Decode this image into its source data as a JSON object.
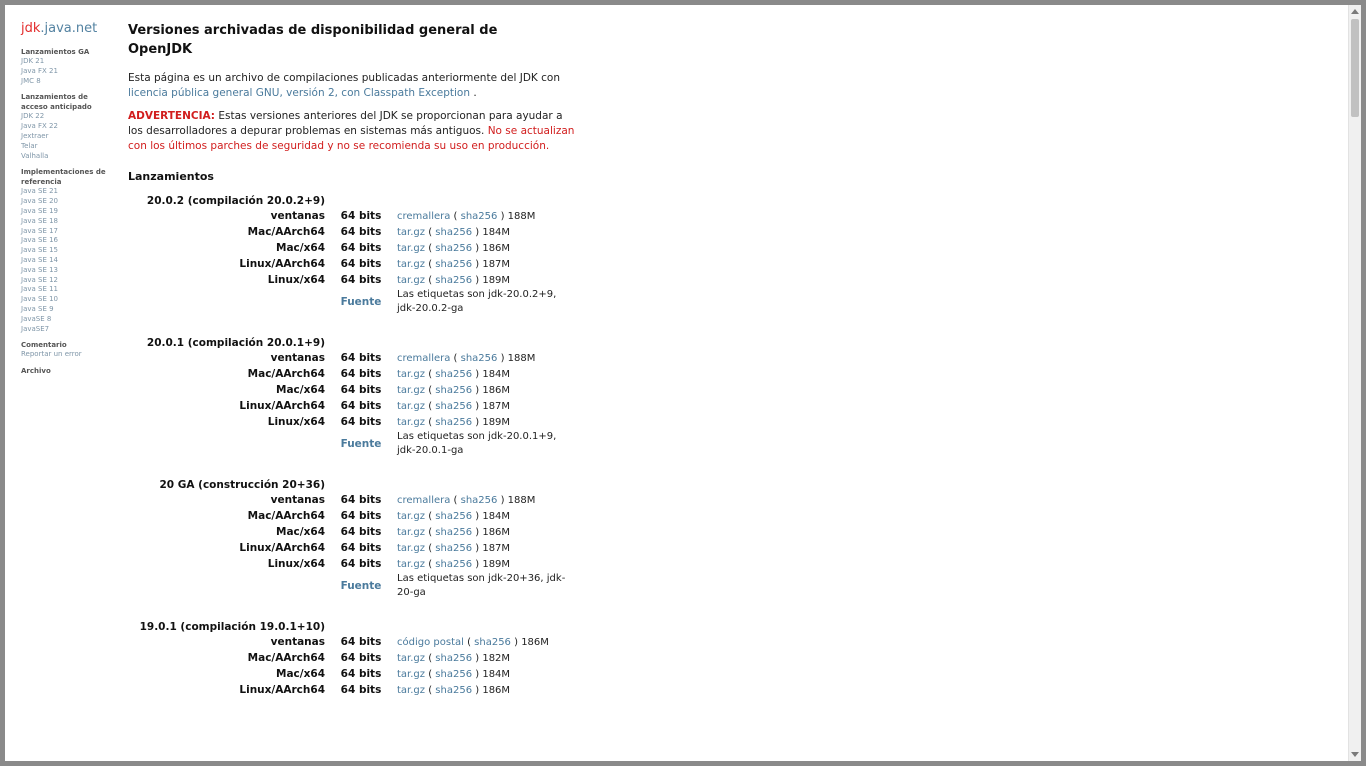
{
  "sidebar": {
    "logo_jdk": "jdk",
    "logo_rest": ".java.net",
    "groups": [
      {
        "head": "Lanzamientos GA",
        "links": [
          "JDK 21",
          "Java FX 21",
          "JMC 8"
        ]
      },
      {
        "head": "Lanzamientos de acceso anticipado",
        "links": [
          "JDK 22",
          "Java FX 22",
          "Jextraer",
          "Telar",
          "Valhalla"
        ]
      },
      {
        "head": "Implementaciones de referencia",
        "links": [
          "Java SE 21",
          "Java SE 20",
          "Java SE 19",
          "Java SE 18",
          "Java SE 17",
          "Java SE 16",
          "Java SE 15",
          "Java SE 14",
          "Java SE 13",
          "Java SE 12",
          "Java SE 11",
          "Java SE 10",
          "Java SE 9",
          "JavaSE 8",
          "JavaSE7"
        ]
      },
      {
        "head": "Comentario",
        "links": [
          "Reportar un error"
        ]
      },
      {
        "head": "Archivo",
        "links": []
      }
    ]
  },
  "main": {
    "title": "Versiones archivadas de disponibilidad general de OpenJDK",
    "intro_text": "Esta página es un archivo de compilaciones publicadas anteriormente del JDK con",
    "intro_link": "licencia pública general GNU, versión 2, con Classpath Exception",
    "intro_end": " .",
    "warning_label": "ADVERTENCIA:",
    "warning_text": " Estas versiones anteriores del JDK se proporcionan para ayudar a los desarrolladores a depurar problemas en sistemas más antiguos. ",
    "warning_red": "No se actualizan con los últimos parches de seguridad y no se recomienda su uso en producción.",
    "releases_heading": "Lanzamientos",
    "releases": [
      {
        "title": "20.0.2 (compilación 20.0.2+9)",
        "rows": [
          {
            "platform": "ventanas",
            "arch": "64 bits",
            "file": "cremallera",
            "sha": "sha256",
            "size": "188M"
          },
          {
            "platform": "Mac/AArch64",
            "arch": "64 bits",
            "file": "tar.gz",
            "sha": "sha256",
            "size": "184M"
          },
          {
            "platform": "Mac/x64",
            "arch": "64 bits",
            "file": "tar.gz",
            "sha": "sha256",
            "size": "186M"
          },
          {
            "platform": "Linux/AArch64",
            "arch": "64 bits",
            "file": "tar.gz",
            "sha": "sha256",
            "size": "187M"
          },
          {
            "platform": "Linux/x64",
            "arch": "64 bits",
            "file": "tar.gz",
            "sha": "sha256",
            "size": "189M"
          }
        ],
        "source_label": "Fuente",
        "source_note": "Las etiquetas son jdk-20.0.2+9, jdk-20.0.2-ga"
      },
      {
        "title": "20.0.1 (compilación 20.0.1+9)",
        "rows": [
          {
            "platform": "ventanas",
            "arch": "64 bits",
            "file": "cremallera",
            "sha": "sha256",
            "size": "188M"
          },
          {
            "platform": "Mac/AArch64",
            "arch": "64 bits",
            "file": "tar.gz",
            "sha": "sha256",
            "size": "184M"
          },
          {
            "platform": "Mac/x64",
            "arch": "64 bits",
            "file": "tar.gz",
            "sha": "sha256",
            "size": "186M"
          },
          {
            "platform": "Linux/AArch64",
            "arch": "64 bits",
            "file": "tar.gz",
            "sha": "sha256",
            "size": "187M"
          },
          {
            "platform": "Linux/x64",
            "arch": "64 bits",
            "file": "tar.gz",
            "sha": "sha256",
            "size": "189M"
          }
        ],
        "source_label": "Fuente",
        "source_note": "Las etiquetas son jdk-20.0.1+9, jdk-20.0.1-ga"
      },
      {
        "title": "20 GA (construcción 20+36)",
        "rows": [
          {
            "platform": "ventanas",
            "arch": "64 bits",
            "file": "cremallera",
            "sha": "sha256",
            "size": "188M"
          },
          {
            "platform": "Mac/AArch64",
            "arch": "64 bits",
            "file": "tar.gz",
            "sha": "sha256",
            "size": "184M"
          },
          {
            "platform": "Mac/x64",
            "arch": "64 bits",
            "file": "tar.gz",
            "sha": "sha256",
            "size": "186M"
          },
          {
            "platform": "Linux/AArch64",
            "arch": "64 bits",
            "file": "tar.gz",
            "sha": "sha256",
            "size": "187M"
          },
          {
            "platform": "Linux/x64",
            "arch": "64 bits",
            "file": "tar.gz",
            "sha": "sha256",
            "size": "189M"
          }
        ],
        "source_label": "Fuente",
        "source_note": "Las etiquetas son jdk-20+36, jdk-20-ga"
      },
      {
        "title": "19.0.1 (compilación 19.0.1+10)",
        "rows": [
          {
            "platform": "ventanas",
            "arch": "64 bits",
            "file": "código postal",
            "sha": "sha256",
            "size": "186M"
          },
          {
            "platform": "Mac/AArch64",
            "arch": "64 bits",
            "file": "tar.gz",
            "sha": "sha256",
            "size": "182M"
          },
          {
            "platform": "Mac/x64",
            "arch": "64 bits",
            "file": "tar.gz",
            "sha": "sha256",
            "size": "184M"
          },
          {
            "platform": "Linux/AArch64",
            "arch": "64 bits",
            "file": "tar.gz",
            "sha": "sha256",
            "size": "186M"
          }
        ],
        "source_label": "",
        "source_note": ""
      }
    ]
  }
}
